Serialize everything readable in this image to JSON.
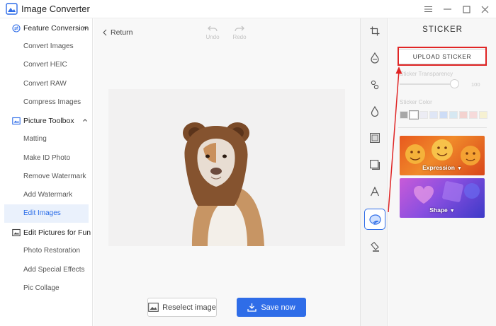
{
  "app": {
    "title": "Image Converter",
    "accent": "#2f6de8",
    "highlight": "#e02525"
  },
  "window_controls": [
    "menu-icon",
    "minimize-icon",
    "maximize-icon",
    "close-icon"
  ],
  "sidebar": {
    "sections": [
      {
        "label": "Feature Conversion",
        "icon": "convert-icon",
        "items": [
          "Convert Images",
          "Convert HEIC",
          "Convert RAW",
          "Compress Images"
        ]
      },
      {
        "label": "Picture Toolbox",
        "icon": "toolbox-icon",
        "items": [
          "Matting",
          "Make ID Photo",
          "Remove Watermark",
          "Add Watermark",
          "Edit Images"
        ]
      },
      {
        "label": "Edit Pictures for Fun",
        "icon": "fun-picture-icon",
        "items": [
          "Photo Restoration",
          "Add Special Effects",
          "Pic Collage"
        ]
      }
    ],
    "active_item": "Edit Images"
  },
  "toolbar": {
    "return_label": "Return",
    "undo_label": "Undo",
    "redo_label": "Redo"
  },
  "actions": {
    "reselect_label": "Reselect image",
    "save_label": "Save now"
  },
  "tools": [
    "crop-icon",
    "adjust-icon",
    "filter-icon",
    "water-drop-icon",
    "frame-icon",
    "border-icon",
    "text-icon",
    "sticker-icon",
    "eraser-icon"
  ],
  "active_tool": "sticker-icon",
  "panel": {
    "title": "STICKER",
    "upload_label": "UPLOAD STICKER",
    "transparency_label": "Sticker Transparency",
    "transparency_value": "100",
    "color_label": "Sticker Color",
    "colors": [
      "#a8a8a8",
      "#ffffff",
      "#ececf4",
      "#dfe6f6",
      "#cddcf6",
      "#d6e8f2",
      "#f3d2cf",
      "#f6dada",
      "#f6f1d2"
    ],
    "cards": [
      {
        "label": "Expression"
      },
      {
        "label": "Shape"
      }
    ]
  }
}
